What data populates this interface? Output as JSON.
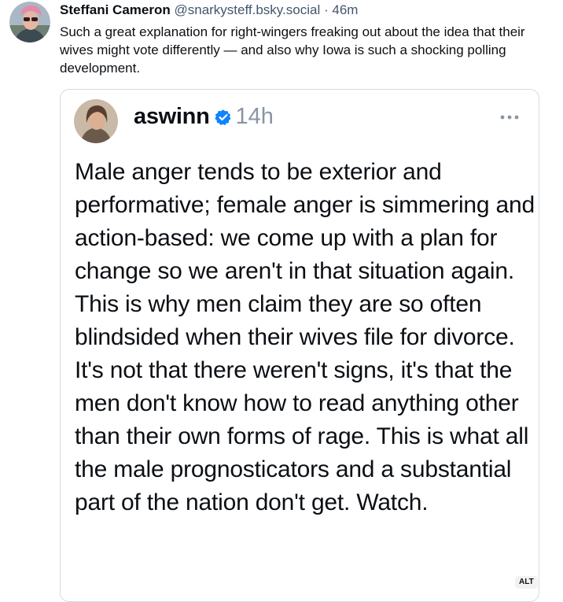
{
  "post": {
    "author_name": "Steffani Cameron",
    "author_handle": "@snarkysteff.bsky.social",
    "separator": "·",
    "time_ago": "46m",
    "text": "Such a great explanation for right-wingers freaking out about the idea that their wives might vote differently — and also why Iowa is such a shocking polling development."
  },
  "embed": {
    "author_name": "aswinn",
    "verified_icon": "verified-badge-icon",
    "time_ago": "14h",
    "more_icon": "more-options-icon",
    "text": "Male anger tends to be exterior and performative; female anger is simmering and action-based: we come up with a plan for change so we aren't in that situation again. This is why men claim they are so often blindsided when their wives file for divorce. It's not that there weren't signs, it's that the men don't know how to read anything other than their own forms of rage. This is what all the male prognosticators and a substantial part of the nation don't get. Watch.",
    "alt_badge": "ALT"
  },
  "colors": {
    "text_primary": "#0b0f14",
    "text_secondary": "#42576c",
    "border": "#d4dbe2",
    "verified_blue": "#1083fe"
  }
}
